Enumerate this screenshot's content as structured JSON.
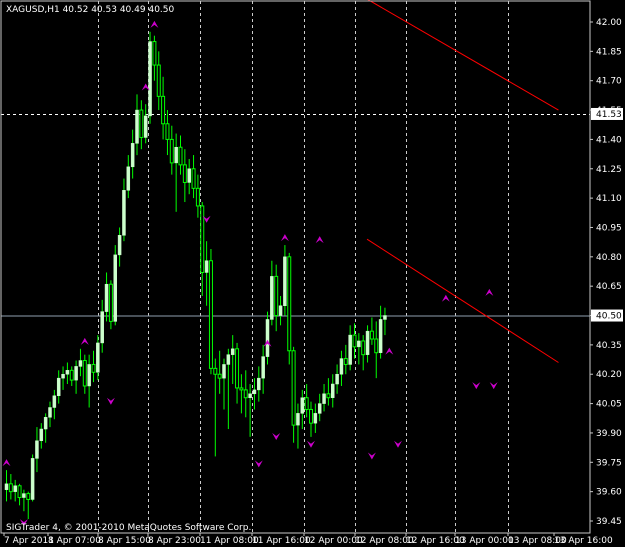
{
  "symbol_header": "XAGUSD,H1  40.52 40.53 40.49 40.50",
  "copyright": "SIGTrader 4, © 2001-2010 MetaQuotes Software Corp.",
  "colors": {
    "background": "#000000",
    "frame": "#c8c8c8",
    "grid": "#ffffff",
    "bull_candle": "#ccffcc",
    "wick": "#00ff00",
    "trendline": "#ff0000",
    "fractal_marker": "#cc00cc",
    "price_tag_bg": "#ffffff",
    "price_tag_text": "#000000"
  },
  "price_axis": {
    "labels": [
      "42.00",
      "41.85",
      "41.70",
      "41.55",
      "41.40",
      "41.25",
      "41.10",
      "40.95",
      "40.80",
      "40.65",
      "40.50",
      "40.35",
      "40.20",
      "40.05",
      "39.90",
      "39.75",
      "39.60",
      "39.45"
    ],
    "tag_labels": [
      "41.53",
      "40.50"
    ]
  },
  "time_axis": {
    "labels": [
      "7 Apr 2011",
      "8 Apr 07:00",
      "8 Apr 15:00",
      "8 Apr 23:00",
      "11 Apr 08:00",
      "11 Apr 16:00",
      "12 Apr 00:00",
      "12 Apr 08:00",
      "12 Apr 16:00",
      "13 Apr 00:00",
      "13 Apr 08:00",
      "13 Apr 16:00"
    ]
  },
  "chart_data": {
    "type": "candlestick",
    "symbol": "XAGUSD",
    "timeframe": "H1",
    "ylim": [
      39.42,
      42.1
    ],
    "current_price": 40.5,
    "horizontal_lines": [
      41.53,
      40.5
    ],
    "vertical_grid_after_labels": [
      2,
      3,
      4,
      5,
      6,
      7,
      8,
      9,
      10
    ],
    "candles": [
      {
        "o": 39.61,
        "h": 39.71,
        "l": 39.55,
        "c": 39.64
      },
      {
        "o": 39.64,
        "h": 39.69,
        "l": 39.56,
        "c": 39.6
      },
      {
        "o": 39.6,
        "h": 39.66,
        "l": 39.55,
        "c": 39.63
      },
      {
        "o": 39.63,
        "h": 39.64,
        "l": 39.53,
        "c": 39.57
      },
      {
        "o": 39.57,
        "h": 39.61,
        "l": 39.5,
        "c": 39.59
      },
      {
        "o": 39.59,
        "h": 39.6,
        "l": 39.46,
        "c": 39.56
      },
      {
        "o": 39.56,
        "h": 39.79,
        "l": 39.55,
        "c": 39.77
      },
      {
        "o": 39.77,
        "h": 39.93,
        "l": 39.7,
        "c": 39.86
      },
      {
        "o": 39.86,
        "h": 39.95,
        "l": 39.82,
        "c": 39.92
      },
      {
        "o": 39.92,
        "h": 40.0,
        "l": 39.85,
        "c": 39.98
      },
      {
        "o": 39.98,
        "h": 40.06,
        "l": 39.93,
        "c": 40.03
      },
      {
        "o": 40.03,
        "h": 40.12,
        "l": 39.97,
        "c": 40.09
      },
      {
        "o": 40.09,
        "h": 40.22,
        "l": 40.05,
        "c": 40.18
      },
      {
        "o": 40.18,
        "h": 40.24,
        "l": 40.12,
        "c": 40.2
      },
      {
        "o": 40.2,
        "h": 40.26,
        "l": 40.15,
        "c": 40.22
      },
      {
        "o": 40.22,
        "h": 40.24,
        "l": 40.14,
        "c": 40.17
      },
      {
        "o": 40.17,
        "h": 40.27,
        "l": 40.1,
        "c": 40.24
      },
      {
        "o": 40.24,
        "h": 40.33,
        "l": 40.19,
        "c": 40.27
      },
      {
        "o": 40.27,
        "h": 40.3,
        "l": 40.1,
        "c": 40.14
      },
      {
        "o": 40.14,
        "h": 40.3,
        "l": 40.03,
        "c": 40.25
      },
      {
        "o": 40.25,
        "h": 40.32,
        "l": 40.16,
        "c": 40.21
      },
      {
        "o": 40.21,
        "h": 40.4,
        "l": 40.17,
        "c": 40.36
      },
      {
        "o": 40.36,
        "h": 40.58,
        "l": 40.31,
        "c": 40.52
      },
      {
        "o": 40.52,
        "h": 40.72,
        "l": 40.47,
        "c": 40.66
      },
      {
        "o": 40.66,
        "h": 40.68,
        "l": 40.43,
        "c": 40.47
      },
      {
        "o": 40.47,
        "h": 40.86,
        "l": 40.45,
        "c": 40.81
      },
      {
        "o": 40.81,
        "h": 40.95,
        "l": 40.75,
        "c": 40.91
      },
      {
        "o": 40.91,
        "h": 41.2,
        "l": 40.88,
        "c": 41.14
      },
      {
        "o": 41.14,
        "h": 41.32,
        "l": 41.1,
        "c": 41.26
      },
      {
        "o": 41.26,
        "h": 41.45,
        "l": 41.2,
        "c": 41.38
      },
      {
        "o": 41.38,
        "h": 41.63,
        "l": 41.32,
        "c": 41.55
      },
      {
        "o": 41.55,
        "h": 41.6,
        "l": 41.35,
        "c": 41.41
      },
      {
        "o": 41.41,
        "h": 41.58,
        "l": 41.38,
        "c": 41.52
      },
      {
        "o": 41.52,
        "h": 41.95,
        "l": 41.48,
        "c": 41.9
      },
      {
        "o": 41.9,
        "h": 41.93,
        "l": 41.7,
        "c": 41.78
      },
      {
        "o": 41.78,
        "h": 41.85,
        "l": 41.55,
        "c": 41.62
      },
      {
        "o": 41.62,
        "h": 41.72,
        "l": 41.4,
        "c": 41.48
      },
      {
        "o": 41.48,
        "h": 41.55,
        "l": 41.32,
        "c": 41.4
      },
      {
        "o": 41.4,
        "h": 41.47,
        "l": 41.22,
        "c": 41.28
      },
      {
        "o": 41.28,
        "h": 41.43,
        "l": 41.03,
        "c": 41.36
      },
      {
        "o": 41.36,
        "h": 41.42,
        "l": 41.22,
        "c": 41.27
      },
      {
        "o": 41.27,
        "h": 41.35,
        "l": 41.08,
        "c": 41.18
      },
      {
        "o": 41.18,
        "h": 41.3,
        "l": 41.12,
        "c": 41.25
      },
      {
        "o": 41.25,
        "h": 41.32,
        "l": 41.1,
        "c": 41.15
      },
      {
        "o": 41.15,
        "h": 41.22,
        "l": 41.0,
        "c": 41.06
      },
      {
        "o": 41.06,
        "h": 41.08,
        "l": 40.6,
        "c": 40.72
      },
      {
        "o": 40.72,
        "h": 40.88,
        "l": 40.55,
        "c": 40.78
      },
      {
        "o": 40.78,
        "h": 40.84,
        "l": 40.2,
        "c": 40.23
      },
      {
        "o": 40.23,
        "h": 40.28,
        "l": 39.78,
        "c": 40.2
      },
      {
        "o": 40.2,
        "h": 40.32,
        "l": 40.1,
        "c": 40.18
      },
      {
        "o": 40.18,
        "h": 40.28,
        "l": 40.02,
        "c": 40.25
      },
      {
        "o": 40.25,
        "h": 40.33,
        "l": 39.92,
        "c": 40.3
      },
      {
        "o": 40.3,
        "h": 40.4,
        "l": 40.15,
        "c": 40.33
      },
      {
        "o": 40.33,
        "h": 40.36,
        "l": 40.05,
        "c": 40.13
      },
      {
        "o": 40.13,
        "h": 40.2,
        "l": 40.0,
        "c": 40.12
      },
      {
        "o": 40.12,
        "h": 40.22,
        "l": 39.98,
        "c": 40.08
      },
      {
        "o": 40.08,
        "h": 40.15,
        "l": 39.88,
        "c": 40.1
      },
      {
        "o": 40.1,
        "h": 40.18,
        "l": 40.02,
        "c": 40.12
      },
      {
        "o": 40.12,
        "h": 40.24,
        "l": 40.06,
        "c": 40.18
      },
      {
        "o": 40.18,
        "h": 40.35,
        "l": 40.1,
        "c": 40.29
      },
      {
        "o": 40.29,
        "h": 40.52,
        "l": 40.25,
        "c": 40.48
      },
      {
        "o": 40.48,
        "h": 40.78,
        "l": 40.45,
        "c": 40.7
      },
      {
        "o": 40.7,
        "h": 40.76,
        "l": 40.42,
        "c": 40.5
      },
      {
        "o": 40.5,
        "h": 40.6,
        "l": 40.45,
        "c": 40.55
      },
      {
        "o": 40.55,
        "h": 40.86,
        "l": 40.5,
        "c": 40.8
      },
      {
        "o": 40.8,
        "h": 40.82,
        "l": 40.25,
        "c": 40.32
      },
      {
        "o": 40.32,
        "h": 40.34,
        "l": 39.85,
        "c": 39.94
      },
      {
        "o": 39.94,
        "h": 40.05,
        "l": 39.82,
        "c": 40.0
      },
      {
        "o": 40.0,
        "h": 40.12,
        "l": 39.92,
        "c": 40.08
      },
      {
        "o": 40.08,
        "h": 40.15,
        "l": 39.98,
        "c": 40.02
      },
      {
        "o": 40.02,
        "h": 40.06,
        "l": 39.88,
        "c": 39.95
      },
      {
        "o": 39.95,
        "h": 40.05,
        "l": 39.9,
        "c": 40.0
      },
      {
        "o": 40.0,
        "h": 40.1,
        "l": 39.96,
        "c": 40.05
      },
      {
        "o": 40.05,
        "h": 40.15,
        "l": 40.01,
        "c": 40.1
      },
      {
        "o": 40.1,
        "h": 40.18,
        "l": 40.04,
        "c": 40.08
      },
      {
        "o": 40.08,
        "h": 40.2,
        "l": 40.03,
        "c": 40.15
      },
      {
        "o": 40.15,
        "h": 40.25,
        "l": 40.1,
        "c": 40.2
      },
      {
        "o": 40.2,
        "h": 40.32,
        "l": 40.14,
        "c": 40.28
      },
      {
        "o": 40.28,
        "h": 40.35,
        "l": 40.2,
        "c": 40.25
      },
      {
        "o": 40.25,
        "h": 40.45,
        "l": 40.22,
        "c": 40.4
      },
      {
        "o": 40.4,
        "h": 40.46,
        "l": 40.28,
        "c": 40.34
      },
      {
        "o": 40.34,
        "h": 40.41,
        "l": 40.25,
        "c": 40.37
      },
      {
        "o": 40.37,
        "h": 40.4,
        "l": 40.22,
        "c": 40.3
      },
      {
        "o": 40.3,
        "h": 40.45,
        "l": 40.26,
        "c": 40.42
      },
      {
        "o": 40.42,
        "h": 40.49,
        "l": 40.35,
        "c": 40.38
      },
      {
        "o": 40.38,
        "h": 40.47,
        "l": 40.18,
        "c": 40.31
      },
      {
        "o": 40.31,
        "h": 40.55,
        "l": 40.28,
        "c": 40.48
      },
      {
        "o": 40.48,
        "h": 40.54,
        "l": 40.4,
        "c": 40.5
      }
    ],
    "fractals_up": [
      {
        "i": 0,
        "p": 39.72
      },
      {
        "i": 18,
        "p": 40.34
      },
      {
        "i": 32,
        "p": 41.64
      },
      {
        "i": 34,
        "p": 41.96
      },
      {
        "i": 60,
        "p": 40.33
      },
      {
        "i": 64,
        "p": 40.87
      },
      {
        "i": 72,
        "p": 40.86
      },
      {
        "i": 88,
        "p": 40.29
      },
      {
        "i": 101,
        "p": 40.56
      },
      {
        "i": 111,
        "p": 40.59
      }
    ],
    "fractals_down": [
      {
        "i": 4,
        "p": 39.47
      },
      {
        "i": 24,
        "p": 40.09
      },
      {
        "i": 46,
        "p": 41.02
      },
      {
        "i": 58,
        "p": 39.77
      },
      {
        "i": 62,
        "p": 39.91
      },
      {
        "i": 70,
        "p": 39.87
      },
      {
        "i": 84,
        "p": 39.81
      },
      {
        "i": 90,
        "p": 39.87
      },
      {
        "i": 108,
        "p": 40.17
      },
      {
        "i": 112,
        "p": 40.17
      }
    ],
    "trendlines": [
      {
        "from": {
          "i": 82,
          "p": 42.13
        },
        "to": {
          "i": 127,
          "p": 41.55
        }
      },
      {
        "from": {
          "i": 83,
          "p": 40.89
        },
        "to": {
          "i": 127,
          "p": 40.26
        }
      }
    ]
  }
}
